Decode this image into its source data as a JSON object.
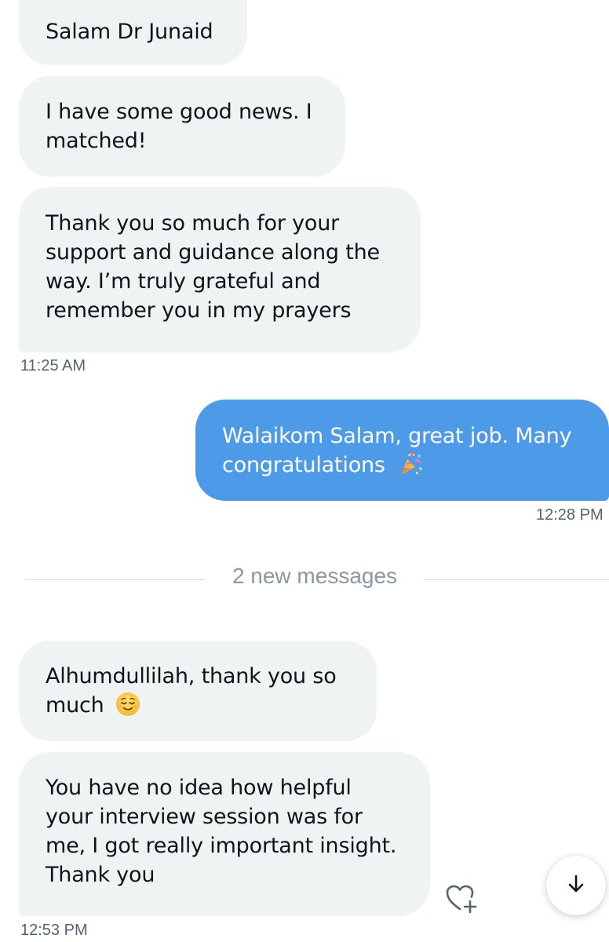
{
  "conversation": {
    "messages": [
      {
        "direction": "incoming",
        "lines": [
          "Salam Dr Junaid"
        ]
      },
      {
        "direction": "incoming",
        "lines": [
          "I have some good news. I",
          "matched!"
        ]
      },
      {
        "direction": "incoming",
        "lines": [
          "Thank you so much for your",
          "support and guidance along the",
          "way. I’m truly grateful and",
          "remember you in my prayers"
        ],
        "timestamp": "11:25 AM"
      },
      {
        "direction": "outgoing",
        "lines": [
          "Walaikom Salam, great job. Many",
          "congratulations"
        ],
        "emoji": "confetti-emoji",
        "timestamp": "12:28 PM"
      },
      {
        "direction": "incoming",
        "lines": [
          "Alhumdullilah, thank you so",
          "much"
        ],
        "emoji": "relieved-face-emoji"
      },
      {
        "direction": "incoming",
        "lines": [
          "You have no idea how helpful",
          "your interview session was for",
          "me, I got really important insight.",
          "Thank you"
        ],
        "timestamp": "12:53 PM"
      }
    ],
    "new_messages_divider": "2 new messages"
  },
  "controls": {
    "react_icon": "heart-plus-icon",
    "scroll_icon": "arrow-down-icon"
  },
  "colors": {
    "incoming_bubble": "#eff3f4",
    "outgoing_bubble": "#4c9ae8",
    "text": "#0f1419",
    "timestamp": "#536471",
    "divider_text": "#8a98a3"
  }
}
